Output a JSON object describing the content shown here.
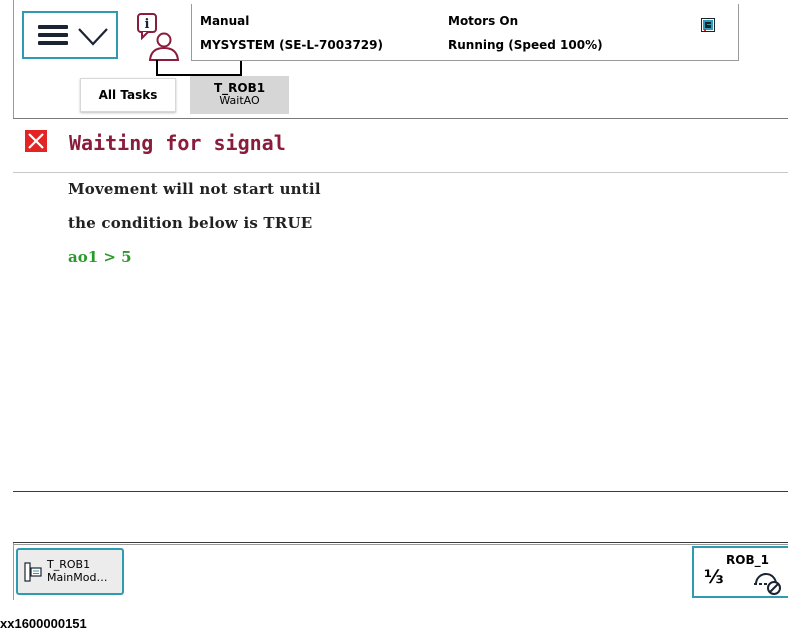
{
  "topbar": {
    "operating_mode": "Manual",
    "system_name": "MYSYSTEM (SE-L-7003729)",
    "motors_state": "Motors On",
    "program_state": "Running (Speed 100%)"
  },
  "icons": {
    "menu": "hamburger-icon",
    "menu_expand": "chevron-down-icon",
    "event_log": "info-person-icon",
    "speed": "speed-status-icon",
    "close": "close-icon",
    "task_module": "module-icon",
    "jog_tool": "tool-icon"
  },
  "tabs": [
    {
      "label": "All Tasks"
    },
    {
      "label": "T_ROB1",
      "sublabel": "WaitAO",
      "active": true
    }
  ],
  "dialog": {
    "title": "Waiting for signal",
    "message_line1": "Movement will not start until",
    "message_line2": "the condition below is TRUE",
    "condition": "ao1 > 5"
  },
  "taskbar": {
    "task_line1": "T_ROB1",
    "task_line2": "MainMod…",
    "mechunit_label": "ROB_1",
    "increment": "⅓"
  },
  "figure_id": "xx1600000151",
  "colors": {
    "accent": "#2e9bb3",
    "title": "#8a1c3c",
    "condition": "#2b9a2b",
    "close": "#e22424",
    "active_tab": "#d6d6d6"
  }
}
